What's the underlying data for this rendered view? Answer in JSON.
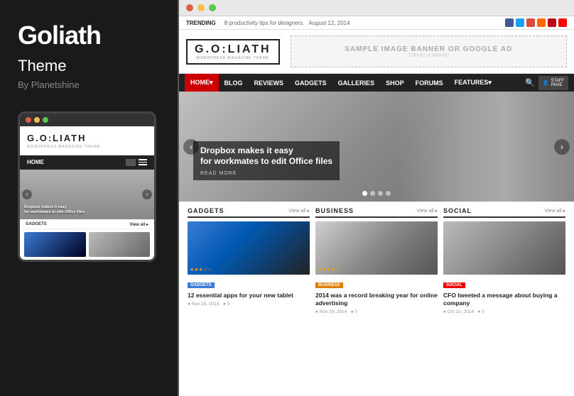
{
  "left": {
    "title": "Goliath",
    "subtitle": "Theme",
    "author": "By Planetshine",
    "mobile": {
      "logo": "G.O.LIATH",
      "logo_sub": "WORDPRESS MAGAZINE THEME",
      "nav_home": "HOME",
      "hero_text1": "Dropbox makes it easy",
      "hero_text2": "for workmates to edit Office files",
      "section_label": "GADGETS",
      "section_view_all": "View all ▸"
    }
  },
  "browser": {
    "trending_label": "TRENDING",
    "trending_text": "8 productivity tips for designers.",
    "trending_date": "August 12, 2014",
    "ad_text": "SAMPLE IMAGE BANNER OR GOOGLE AD",
    "ad_size": "728×90 or 468×60",
    "logo_main": "G.O:LIATH",
    "logo_sub": "WORDPRESS MAGAZINE THEME",
    "nav_items": [
      "HOME",
      "BLOG",
      "REVIEWS",
      "GADGETS",
      "GALLERIES",
      "SHOP",
      "FORUMS",
      "FEATURES"
    ],
    "hero": {
      "caption1": "Dropbox makes it easy",
      "caption2": "for workmates to edit Office files",
      "read_more": "READ MORE"
    },
    "sections": [
      {
        "title": "GADGETS",
        "view_all": "View all ▸",
        "badge": "GADGETS",
        "badge_class": "badge-gadgets",
        "card_image_class": "card-image-gadgets",
        "card_title": "12 essential apps for your new tablet",
        "card_date": "Nov 25, 2014",
        "card_comments": "0",
        "stars": "★★★☆☆"
      },
      {
        "title": "BUSINESS",
        "view_all": "View all ▸",
        "badge": "BUSINESS",
        "badge_class": "badge-business",
        "card_image_class": "card-image-business",
        "card_title": "2014 was a record breaking year for online advertising",
        "card_date": "Nov 20, 2014",
        "card_comments": "0",
        "stars": "★★★★☆"
      },
      {
        "title": "SOCIAL",
        "view_all": "View all ▸",
        "badge": "SOCIAL",
        "badge_class": "badge-social",
        "card_image_class": "card-image-social",
        "card_title": "CFO tweeted a message about buying a company",
        "card_date": "Oct 10, 2014",
        "card_comments": "0",
        "stars": ""
      }
    ]
  }
}
